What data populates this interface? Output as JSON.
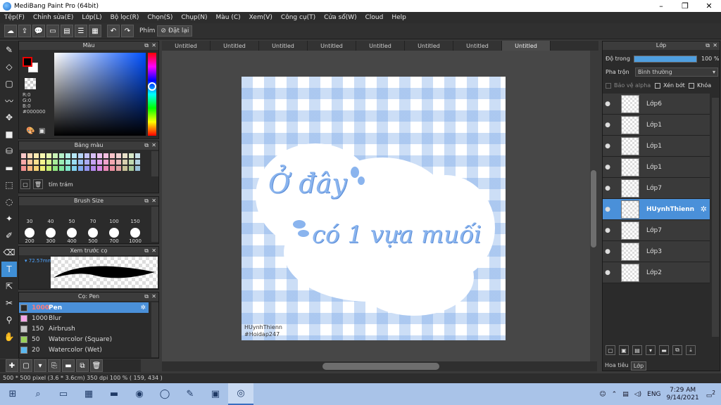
{
  "window": {
    "title": "MediBang Paint Pro (64bit)",
    "minimize_glyph": "–",
    "maximize_glyph": "❐",
    "close_glyph": "✕"
  },
  "menu": [
    "Tệp(F)",
    "Chỉnh sửa(E)",
    "Lớp(L)",
    "Bộ lọc(R)",
    "Chọn(S)",
    "Chụp(N)",
    "Màu (C)",
    "Xem(V)",
    "Công cụ(T)",
    "Cửa sổ(W)",
    "Cloud",
    "Help"
  ],
  "toolbar": {
    "key_label": "Phím",
    "reset_label": "Đặt lại"
  },
  "color_panel": {
    "title": "Màu",
    "r": "R:0",
    "g": "G:0",
    "b": "B:0",
    "hex": "#000000",
    "fg": "#000000",
    "bg": "#ffffff"
  },
  "palette_panel": {
    "title": "Bảng màu",
    "name": "tím trám",
    "colors": [
      "#f9c8c8",
      "#fbd9b5",
      "#fbeab0",
      "#f7f7b0",
      "#e6f7b0",
      "#c9f2b5",
      "#b5f0c8",
      "#b5f0e6",
      "#b5e6f5",
      "#b5d4f7",
      "#c3c3f7",
      "#d6bff5",
      "#ecbff0",
      "#f5bfdf",
      "#f7c3c8",
      "#f0d0d0",
      "#e8e0c8",
      "#d8e8c8",
      "#c8e0e8",
      "#f7a8a8",
      "#f9c89a",
      "#f9df8f",
      "#f4f48f",
      "#d6f48f",
      "#a8ec9a",
      "#9aecb5",
      "#9aecd9",
      "#9adcf2",
      "#9abff4",
      "#ababf4",
      "#c6a3f2",
      "#e2a3ec",
      "#f2a3cc",
      "#f4a8b0",
      "#e8b8b8",
      "#d8d0b0",
      "#c0d8b0",
      "#b0d0e0",
      "#f29090",
      "#f6b680",
      "#f6d275",
      "#eeee75",
      "#c6ee75",
      "#90e680",
      "#80e6a0",
      "#80e6cc",
      "#80d0ee",
      "#80aaf0",
      "#9494f0",
      "#b489ee",
      "#d789e6",
      "#ec89b8",
      "#ee90a0",
      "#e0a0a0",
      "#c8c098",
      "#a8c898",
      "#98c0d8"
    ]
  },
  "brush_size_panel": {
    "title": "Brush Size",
    "sizes": [
      "30",
      "40",
      "50",
      "70",
      "100",
      "150",
      "200",
      "300",
      "400",
      "500",
      "700",
      "1000"
    ]
  },
  "preview_panel": {
    "title": "Xem trước cọ",
    "size": "72.57mm"
  },
  "brush_panel": {
    "title": "Cọ: Pen",
    "brushes": [
      {
        "size": "1000",
        "name": "Pen",
        "color": "#2a2a2a"
      },
      {
        "size": "1000",
        "name": "Blur",
        "color": "#f6a6e8"
      },
      {
        "size": "150",
        "name": "Airbrush",
        "color": "#c8c8c8"
      },
      {
        "size": "50",
        "name": "Watercolor (Square)",
        "color": "#9ad15a"
      },
      {
        "size": "20",
        "name": "Watercolor (Wet)",
        "color": "#5ab8f0"
      }
    ]
  },
  "tabs": [
    "Untitled",
    "Untitled",
    "Untitled",
    "Untitled",
    "Untitled",
    "Untitled",
    "Untitled",
    "Untitled"
  ],
  "canvas": {
    "line1": "Ở đây",
    "line2": "có 1 vựa muối",
    "sign1": "HUynhThienn",
    "sign2": "#Hoidap247"
  },
  "layer_panel": {
    "title": "Lớp",
    "opacity_label": "Độ trong",
    "opacity_value": "100 %",
    "opacity_fraction": 1.0,
    "blend_label": "Pha trộn",
    "blend_value": "Bình thường",
    "alpha_label": "Bảo vệ alpha",
    "clip_label": "Xén bớt",
    "lock_label": "Khóa",
    "layers": [
      {
        "name": "Lớp6"
      },
      {
        "name": "Lớp1"
      },
      {
        "name": "Lớp1"
      },
      {
        "name": "Lớp1"
      },
      {
        "name": "Lớp7"
      },
      {
        "name": "HUynhThienn"
      },
      {
        "name": "Lớp7"
      },
      {
        "name": "Lớp3"
      },
      {
        "name": "Lớp2"
      }
    ],
    "tab_material": "Hoa tiêu",
    "tab_layer": "Lớp"
  },
  "status": "500 * 500 pixel  (3.6 * 3.6cm)  350 dpi  100 %  ( 159, 434 )",
  "taskbar": {
    "lang": "ENG",
    "time": "7:29 AM",
    "date": "9/14/2021",
    "notif": "2"
  }
}
